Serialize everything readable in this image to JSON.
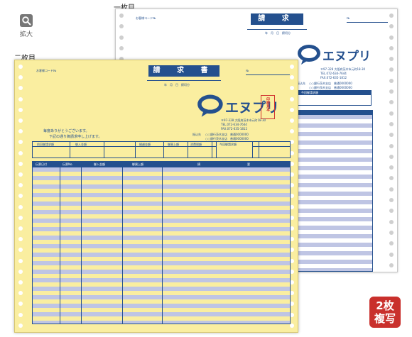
{
  "zoom": {
    "label": "拡大",
    "icon": "magnifier-icon"
  },
  "sheets": {
    "copy1_label": "一枚目",
    "copy2_label": "二枚目"
  },
  "badge": {
    "line1": "2枚",
    "line2": "複写"
  },
  "form": {
    "title": "請 求 書",
    "customer_code": "お客様コード№",
    "no": "№",
    "date_line": "年　月　日　締切分",
    "brand": "エヌプリ",
    "address_line1": "〒97-328 大阪府茨木市元町18-30",
    "tel": "TEL.072-634-7644",
    "fax": "FAX.072-635-1812",
    "bank_label": "振込先",
    "bank1": "○○銀行茨木支店　普通0000000",
    "bank2": "○○銀行茨木支店　普通0000000",
    "greeting1": "毎度ありがとうございます。",
    "greeting2": "下記の通り御請求申し上げます。",
    "summary_headers": [
      "前回御請求額",
      "御入金額",
      "",
      "繰越金額",
      "御買上額",
      "消費税額",
      "今回御請求額"
    ],
    "current_amount_label": "今回御請求額",
    "detail_headers": [
      "伝票日付",
      "伝票No.",
      "御入金額",
      "御買上額",
      "摘",
      "要"
    ],
    "stamp": "印刷見本"
  },
  "colors": {
    "accent": "#24508e",
    "paper_yellow": "#faeea0",
    "stripe": "#bfc5e4",
    "badge": "#c9302c"
  }
}
